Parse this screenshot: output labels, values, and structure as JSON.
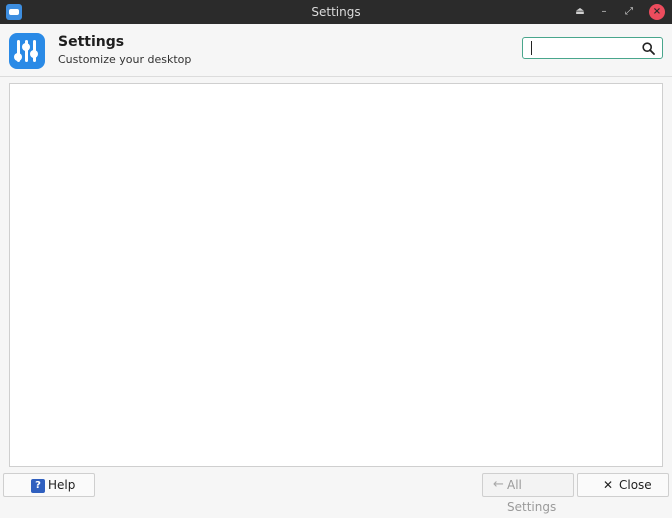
{
  "window": {
    "title": "Settings"
  },
  "header": {
    "title": "Settings",
    "subtitle": "Customize your desktop"
  },
  "search": {
    "value": "",
    "placeholder": ""
  },
  "footer": {
    "help_label": "Help",
    "help_icon_text": "?",
    "all_settings_label": "All Settings",
    "close_label": "Close"
  },
  "icons": {
    "window_keep_above": "eject-icon",
    "window_minimize": "minimize-icon",
    "window_maximize": "maximize-icon",
    "window_close": "close-icon",
    "search": "search-icon",
    "back": "arrow-left-icon",
    "close": "x-icon",
    "help": "help-icon"
  },
  "colors": {
    "titlebar": "#2b2b2b",
    "accent": "#2a8ae6",
    "search_border": "#49a68c",
    "close_button": "#ec4c5d"
  }
}
